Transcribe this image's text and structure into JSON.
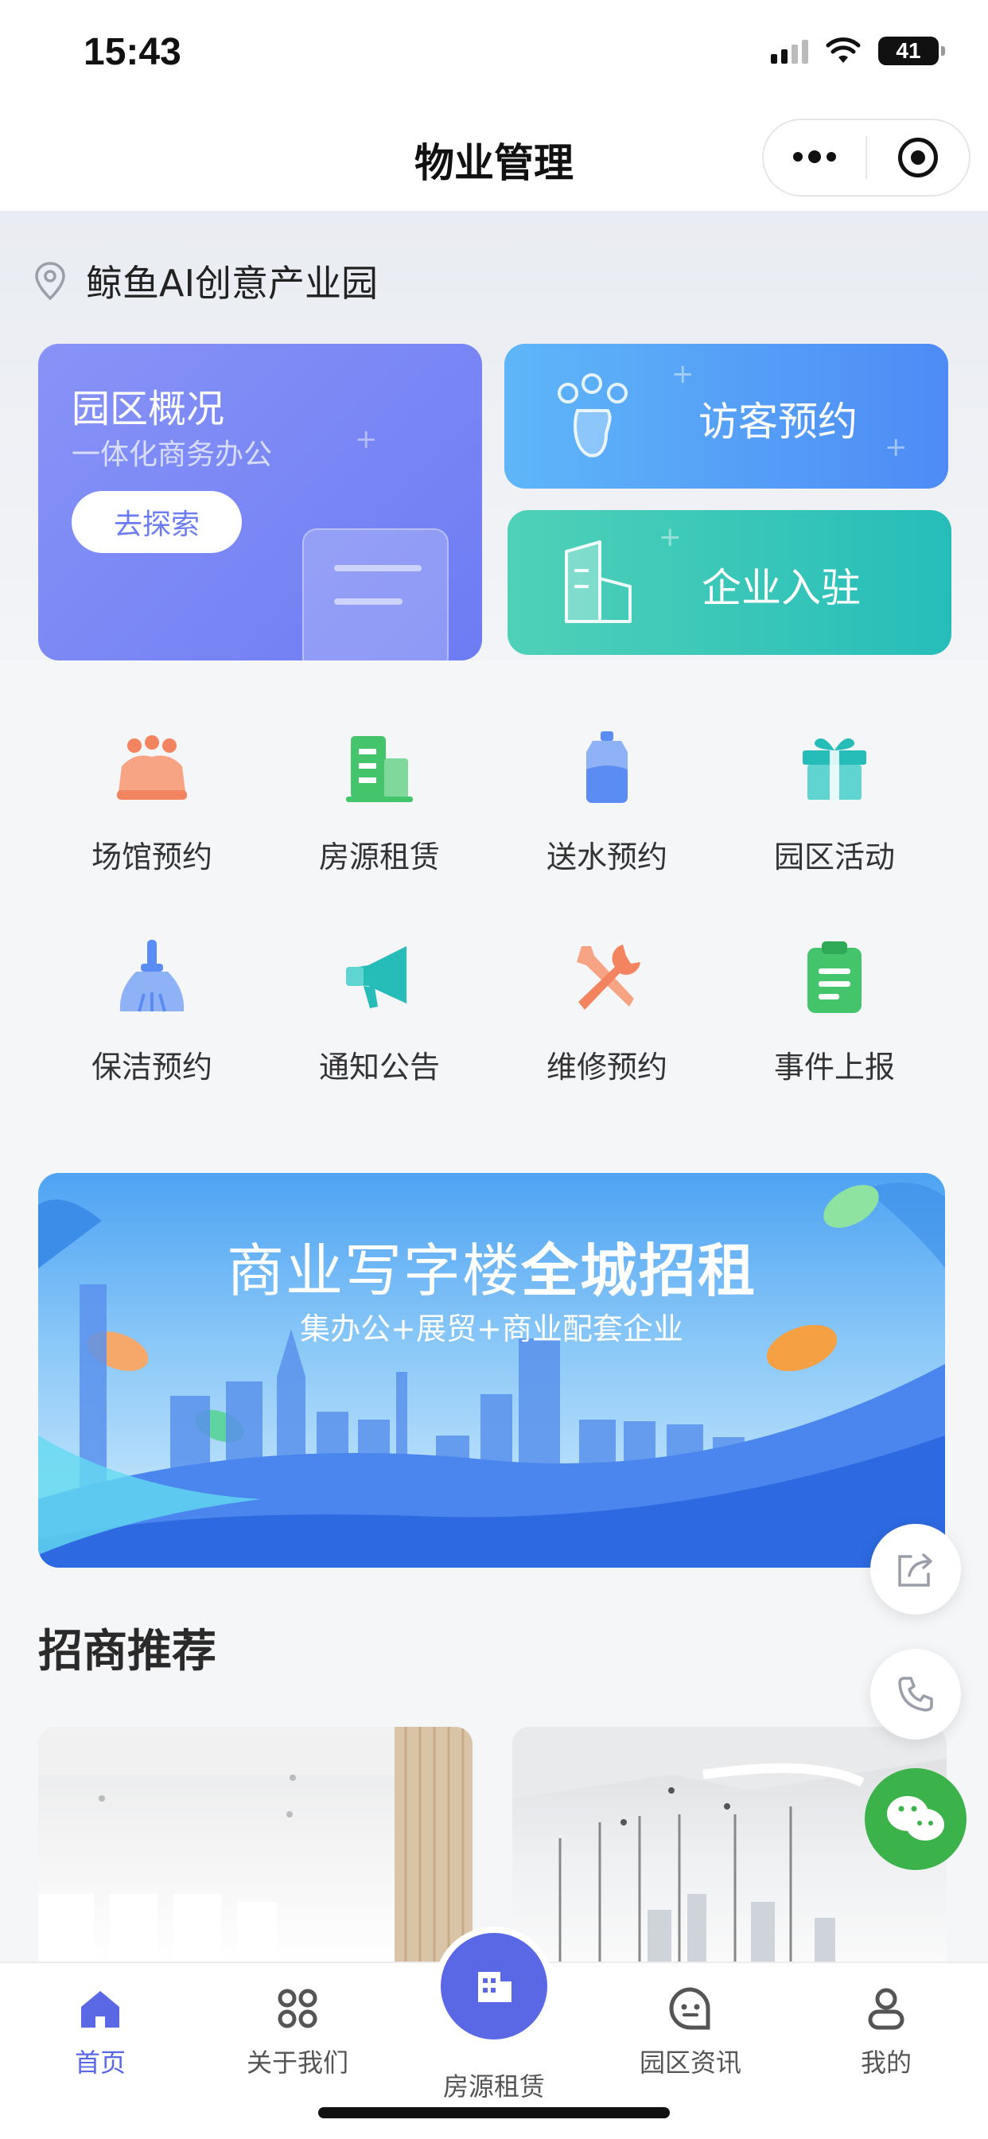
{
  "status_bar": {
    "time": "15:43",
    "battery": "41"
  },
  "nav": {
    "title": "物业管理"
  },
  "location": {
    "text": "鲸鱼AI创意产业园"
  },
  "cards": {
    "overview": {
      "title": "园区概况",
      "subtitle": "一体化商务办公",
      "button": "去探索"
    },
    "visitor": {
      "label": "访客预约"
    },
    "settle": {
      "label": "企业入驻"
    }
  },
  "grid": [
    {
      "label": "场馆预约",
      "icon": "venue-icon",
      "color": "#f2845f"
    },
    {
      "label": "房源租赁",
      "icon": "building-icon",
      "color": "#44c56b"
    },
    {
      "label": "送水预约",
      "icon": "water-bottle-icon",
      "color": "#5b8cf3"
    },
    {
      "label": "园区活动",
      "icon": "gift-icon",
      "color": "#26bdb9"
    },
    {
      "label": "保洁预约",
      "icon": "broom-icon",
      "color": "#5b8cf3"
    },
    {
      "label": "通知公告",
      "icon": "megaphone-icon",
      "color": "#26bdb9"
    },
    {
      "label": "维修预约",
      "icon": "tools-icon",
      "color": "#f2845f"
    },
    {
      "label": "事件上报",
      "icon": "clipboard-icon",
      "color": "#44c56b"
    }
  ],
  "banner": {
    "title_normal": "商业写字楼",
    "title_bold": "全城招租",
    "subtitle": "集办公+展贸+商业配套企业"
  },
  "section": {
    "title": "招商推荐"
  },
  "tabbar": [
    {
      "label": "首页",
      "icon": "home-icon",
      "active": true
    },
    {
      "label": "关于我们",
      "icon": "apps-icon",
      "active": false
    },
    {
      "label": "房源租赁",
      "icon": "building-icon",
      "active": false
    },
    {
      "label": "园区资讯",
      "icon": "chat-icon",
      "active": false
    },
    {
      "label": "我的",
      "icon": "user-icon",
      "active": false
    }
  ],
  "colors": {
    "accent": "#5a68e6",
    "wechat": "#3cb34a"
  }
}
